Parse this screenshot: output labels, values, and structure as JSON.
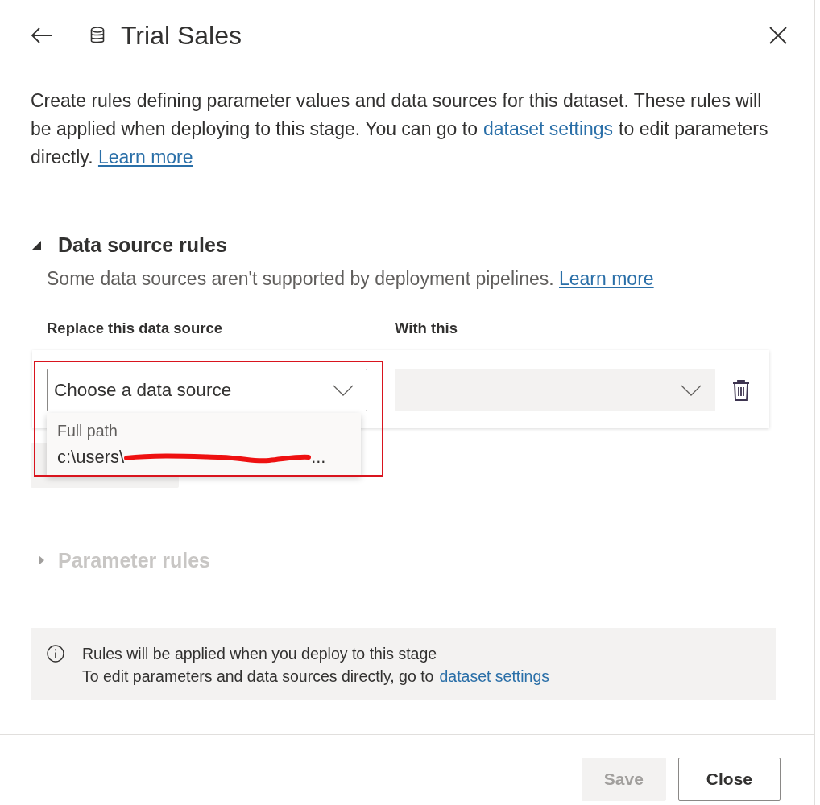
{
  "header": {
    "title": "Trial Sales"
  },
  "description": {
    "text": "Create rules defining parameter values and data sources for this dataset. These rules will be applied when deploying to this stage. You can go to",
    "link": "dataset settings",
    "text_after": "to edit parameters directly.",
    "learn_more": "Learn more"
  },
  "sections": [
    {
      "title": "Data source rules",
      "expanded": true,
      "disabled": false,
      "note": "Some data sources aren't supported by deployment pipelines.",
      "note_link": "Learn more",
      "columns": [
        "Replace this data source",
        "With this"
      ],
      "rules": [
        {
          "source": {
            "placeholder": "Choose a data source",
            "open": true
          },
          "target": {
            "disabled": true
          },
          "highlighted": true,
          "menu": {
            "header": "Full path",
            "option": "c:\\users\\",
            "option_end": "...",
            "redacted": true
          }
        }
      ]
    },
    {
      "title": "Parameter rules",
      "expanded": false,
      "disabled": true
    }
  ],
  "info_bar": {
    "lines": [
      "Rules will be applied when you deploy to this stage",
      "To edit parameters and data sources directly, go to"
    ],
    "link": "dataset settings"
  },
  "buttons": [
    {
      "label": "Save",
      "disabled": true
    },
    {
      "label": "Close",
      "disabled": false
    }
  ]
}
